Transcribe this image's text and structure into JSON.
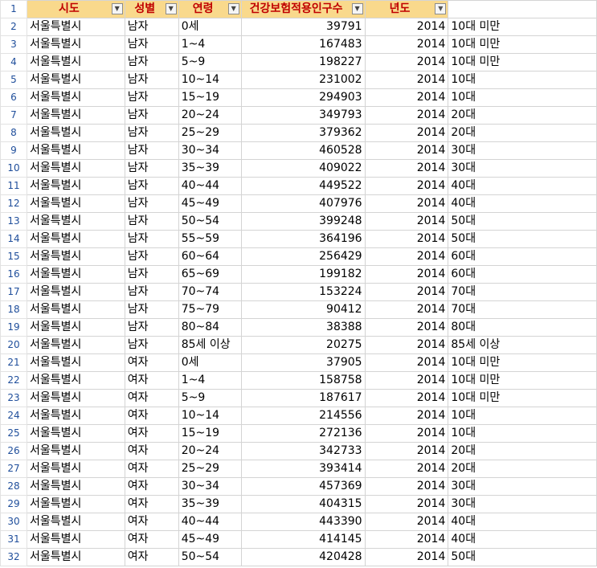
{
  "headers": [
    "시도",
    "성별",
    "연령",
    "건강보험적용인구수",
    "년도"
  ],
  "header_icons": [
    "dropdown-arrow-icon",
    "dropdown-arrow-icon",
    "dropdown-arrow-icon",
    "dropdown-arrow-icon",
    "filter-active-icon"
  ],
  "header_row_number": "1",
  "rows": [
    {
      "n": "2",
      "sido": "서울특별시",
      "sex": "남자",
      "age": "0세",
      "pop": "39791",
      "year": "2014",
      "grp": "10대 미만"
    },
    {
      "n": "3",
      "sido": "서울특별시",
      "sex": "남자",
      "age": "1~4",
      "pop": "167483",
      "year": "2014",
      "grp": "10대 미만"
    },
    {
      "n": "4",
      "sido": "서울특별시",
      "sex": "남자",
      "age": "5~9",
      "pop": "198227",
      "year": "2014",
      "grp": "10대 미만"
    },
    {
      "n": "5",
      "sido": "서울특별시",
      "sex": "남자",
      "age": "10~14",
      "pop": "231002",
      "year": "2014",
      "grp": "10대"
    },
    {
      "n": "6",
      "sido": "서울특별시",
      "sex": "남자",
      "age": "15~19",
      "pop": "294903",
      "year": "2014",
      "grp": "10대"
    },
    {
      "n": "7",
      "sido": "서울특별시",
      "sex": "남자",
      "age": "20~24",
      "pop": "349793",
      "year": "2014",
      "grp": "20대"
    },
    {
      "n": "8",
      "sido": "서울특별시",
      "sex": "남자",
      "age": "25~29",
      "pop": "379362",
      "year": "2014",
      "grp": "20대"
    },
    {
      "n": "9",
      "sido": "서울특별시",
      "sex": "남자",
      "age": "30~34",
      "pop": "460528",
      "year": "2014",
      "grp": "30대"
    },
    {
      "n": "10",
      "sido": "서울특별시",
      "sex": "남자",
      "age": "35~39",
      "pop": "409022",
      "year": "2014",
      "grp": "30대"
    },
    {
      "n": "11",
      "sido": "서울특별시",
      "sex": "남자",
      "age": "40~44",
      "pop": "449522",
      "year": "2014",
      "grp": "40대"
    },
    {
      "n": "12",
      "sido": "서울특별시",
      "sex": "남자",
      "age": "45~49",
      "pop": "407976",
      "year": "2014",
      "grp": "40대"
    },
    {
      "n": "13",
      "sido": "서울특별시",
      "sex": "남자",
      "age": "50~54",
      "pop": "399248",
      "year": "2014",
      "grp": "50대"
    },
    {
      "n": "14",
      "sido": "서울특별시",
      "sex": "남자",
      "age": "55~59",
      "pop": "364196",
      "year": "2014",
      "grp": "50대"
    },
    {
      "n": "15",
      "sido": "서울특별시",
      "sex": "남자",
      "age": "60~64",
      "pop": "256429",
      "year": "2014",
      "grp": "60대"
    },
    {
      "n": "16",
      "sido": "서울특별시",
      "sex": "남자",
      "age": "65~69",
      "pop": "199182",
      "year": "2014",
      "grp": "60대"
    },
    {
      "n": "17",
      "sido": "서울특별시",
      "sex": "남자",
      "age": "70~74",
      "pop": "153224",
      "year": "2014",
      "grp": "70대"
    },
    {
      "n": "18",
      "sido": "서울특별시",
      "sex": "남자",
      "age": "75~79",
      "pop": "90412",
      "year": "2014",
      "grp": "70대"
    },
    {
      "n": "19",
      "sido": "서울특별시",
      "sex": "남자",
      "age": "80~84",
      "pop": "38388",
      "year": "2014",
      "grp": "80대"
    },
    {
      "n": "20",
      "sido": "서울특별시",
      "sex": "남자",
      "age": "85세 이상",
      "pop": "20275",
      "year": "2014",
      "grp": "85세 이상"
    },
    {
      "n": "21",
      "sido": "서울특별시",
      "sex": "여자",
      "age": "0세",
      "pop": "37905",
      "year": "2014",
      "grp": "10대 미만"
    },
    {
      "n": "22",
      "sido": "서울특별시",
      "sex": "여자",
      "age": "1~4",
      "pop": "158758",
      "year": "2014",
      "grp": "10대 미만"
    },
    {
      "n": "23",
      "sido": "서울특별시",
      "sex": "여자",
      "age": "5~9",
      "pop": "187617",
      "year": "2014",
      "grp": "10대 미만"
    },
    {
      "n": "24",
      "sido": "서울특별시",
      "sex": "여자",
      "age": "10~14",
      "pop": "214556",
      "year": "2014",
      "grp": "10대"
    },
    {
      "n": "25",
      "sido": "서울특별시",
      "sex": "여자",
      "age": "15~19",
      "pop": "272136",
      "year": "2014",
      "grp": "10대"
    },
    {
      "n": "26",
      "sido": "서울특별시",
      "sex": "여자",
      "age": "20~24",
      "pop": "342733",
      "year": "2014",
      "grp": "20대"
    },
    {
      "n": "27",
      "sido": "서울특별시",
      "sex": "여자",
      "age": "25~29",
      "pop": "393414",
      "year": "2014",
      "grp": "20대"
    },
    {
      "n": "28",
      "sido": "서울특별시",
      "sex": "여자",
      "age": "30~34",
      "pop": "457369",
      "year": "2014",
      "grp": "30대"
    },
    {
      "n": "29",
      "sido": "서울특별시",
      "sex": "여자",
      "age": "35~39",
      "pop": "404315",
      "year": "2014",
      "grp": "30대"
    },
    {
      "n": "30",
      "sido": "서울특별시",
      "sex": "여자",
      "age": "40~44",
      "pop": "443390",
      "year": "2014",
      "grp": "40대"
    },
    {
      "n": "31",
      "sido": "서울특별시",
      "sex": "여자",
      "age": "45~49",
      "pop": "414145",
      "year": "2014",
      "grp": "40대"
    },
    {
      "n": "32",
      "sido": "서울특별시",
      "sex": "여자",
      "age": "50~54",
      "pop": "420428",
      "year": "2014",
      "grp": "50대"
    }
  ]
}
